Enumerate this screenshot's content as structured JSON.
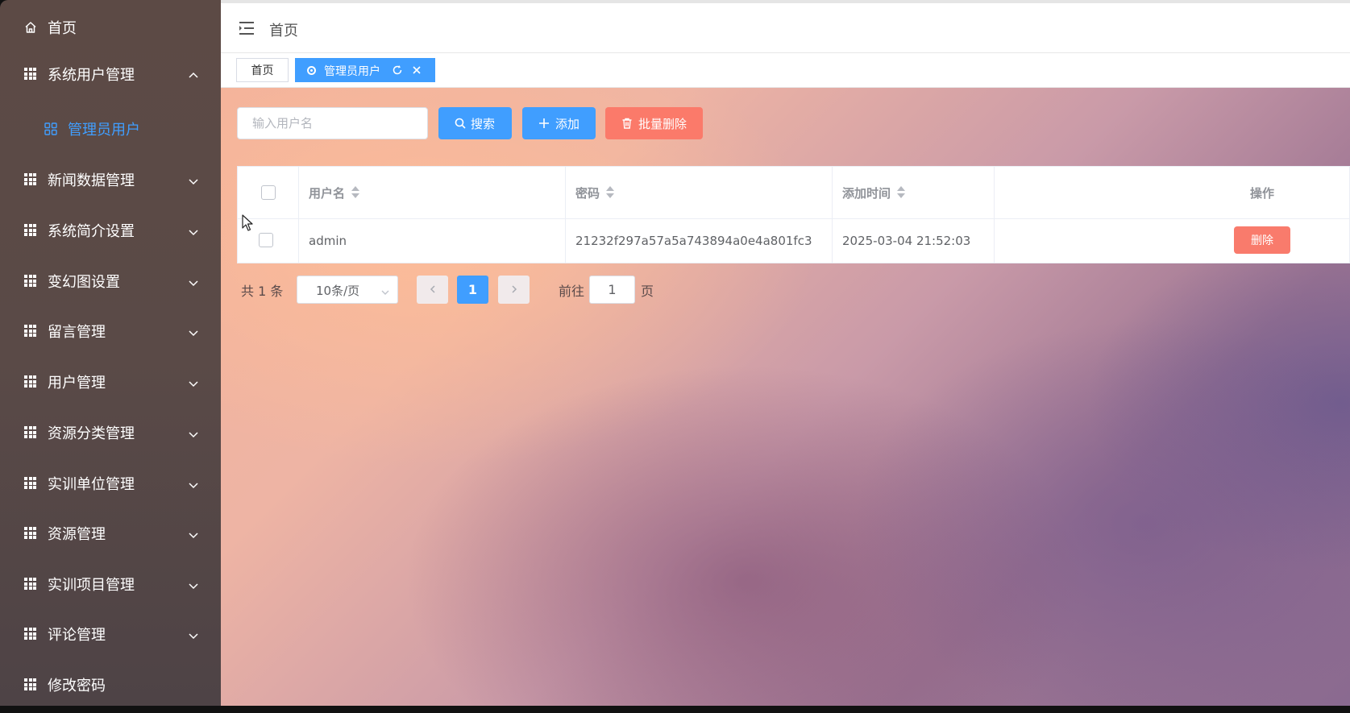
{
  "sidebar": {
    "home_label": "首页",
    "items": [
      {
        "label": "系统用户管理",
        "expanded": true
      },
      {
        "label": "新闻数据管理"
      },
      {
        "label": "系统简介设置"
      },
      {
        "label": "变幻图设置"
      },
      {
        "label": "留言管理"
      },
      {
        "label": "用户管理"
      },
      {
        "label": "资源分类管理"
      },
      {
        "label": "实训单位管理"
      },
      {
        "label": "资源管理"
      },
      {
        "label": "实训项目管理"
      },
      {
        "label": "评论管理"
      },
      {
        "label": "修改密码"
      }
    ],
    "submenu_active": "管理员用户"
  },
  "header": {
    "breadcrumb": "首页"
  },
  "tabs": [
    {
      "label": "首页"
    },
    {
      "label": "管理员用户",
      "active": true
    }
  ],
  "toolbar": {
    "search_placeholder": "输入用户名",
    "search_label": "搜索",
    "add_label": "添加",
    "batch_delete_label": "批量删除"
  },
  "table": {
    "headers": [
      "用户名",
      "密码",
      "添加时间",
      "操作"
    ],
    "rows": [
      {
        "username": "admin",
        "password": "21232f297a57a5a743894a0e4a801fc3",
        "added_time": "2025-03-04 21:52:03",
        "action": "删除"
      }
    ]
  },
  "pagination": {
    "total_text": "共 1 条",
    "page_size": "10条/页",
    "current_page": "1",
    "goto_label": "前往",
    "goto_value": "1",
    "page_suffix": "页"
  },
  "colors": {
    "primary": "#409eff",
    "danger": "#fb7a6a",
    "sidebar_bg": "#5a4a47"
  }
}
